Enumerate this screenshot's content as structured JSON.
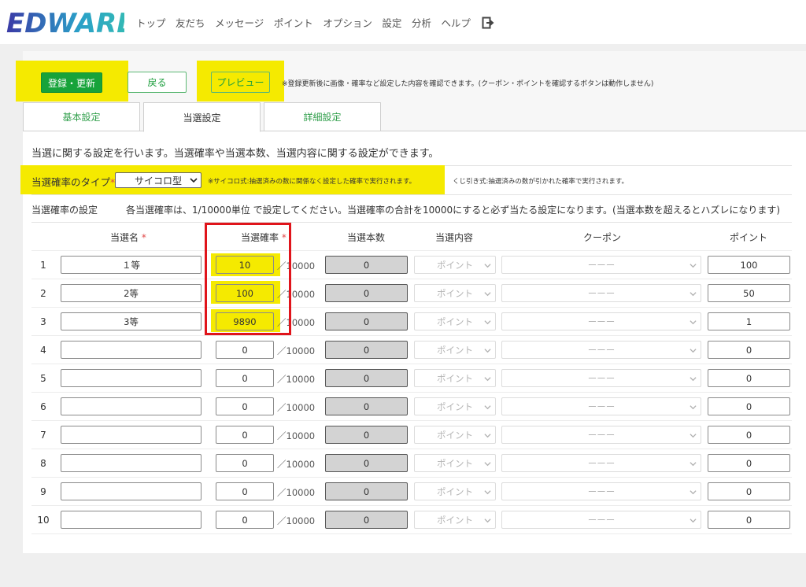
{
  "header": {
    "logo_text": "EDWARD",
    "nav": [
      "トップ",
      "友だち",
      "メッセージ",
      "ポイント",
      "オプション",
      "設定",
      "分析",
      "ヘルプ"
    ]
  },
  "toolbar": {
    "register_label": "登録・更新",
    "back_label": "戻る",
    "preview_label": "プレビュー",
    "preview_note": "※登録更新後に画像・確率など設定した内容を確認できます。(クーポン・ポイントを確認するボタンは動作しません)"
  },
  "tabs": [
    {
      "label": "基本設定"
    },
    {
      "label": "当選設定"
    },
    {
      "label": "詳細設定"
    }
  ],
  "winning": {
    "description": "当選に関する設定を行います。当選確率や当選本数、当選内容に関する設定ができます。",
    "type_label": "当選確率のタイプ",
    "required_mark": "*",
    "type_value": "サイコロ型",
    "note_dice": "※サイコロ式:抽選済みの数に関係なく設定した確率で実行されます。",
    "note_kuji": "くじ引き式:抽選済みの数が引かれた確率で実行されます。",
    "setting_label": "当選確率の設定",
    "setting_note": "各当選確率は、1/10000単位 で設定してください。当選確率の合計を10000にすると必ず当たる設定になります。(当選本数を超えるとハズレになります)"
  },
  "table": {
    "headers": {
      "name": "当選名",
      "rate": "当選確率",
      "count": "当選本数",
      "content": "当選内容",
      "coupon": "クーポン",
      "point": "ポイント"
    },
    "denominator": "／10000",
    "content_placeholder": "ポイント",
    "coupon_placeholder": "ーーー",
    "rows": [
      {
        "no": "1",
        "name": "１等",
        "rate": "10",
        "count": "0",
        "point": "100"
      },
      {
        "no": "2",
        "name": "2等",
        "rate": "100",
        "count": "0",
        "point": "50"
      },
      {
        "no": "3",
        "name": "3等",
        "rate": "9890",
        "count": "0",
        "point": "1"
      },
      {
        "no": "4",
        "name": "",
        "rate": "0",
        "count": "0",
        "point": "0"
      },
      {
        "no": "5",
        "name": "",
        "rate": "0",
        "count": "0",
        "point": "0"
      },
      {
        "no": "6",
        "name": "",
        "rate": "0",
        "count": "0",
        "point": "0"
      },
      {
        "no": "7",
        "name": "",
        "rate": "0",
        "count": "0",
        "point": "0"
      },
      {
        "no": "8",
        "name": "",
        "rate": "0",
        "count": "0",
        "point": "0"
      },
      {
        "no": "9",
        "name": "",
        "rate": "0",
        "count": "0",
        "point": "0"
      },
      {
        "no": "10",
        "name": "",
        "rate": "0",
        "count": "0",
        "point": "0"
      }
    ]
  },
  "colors": {
    "accent_green": "#17a33a",
    "highlight_yellow": "#f5ea00",
    "annotation_red": "#e0141b"
  }
}
